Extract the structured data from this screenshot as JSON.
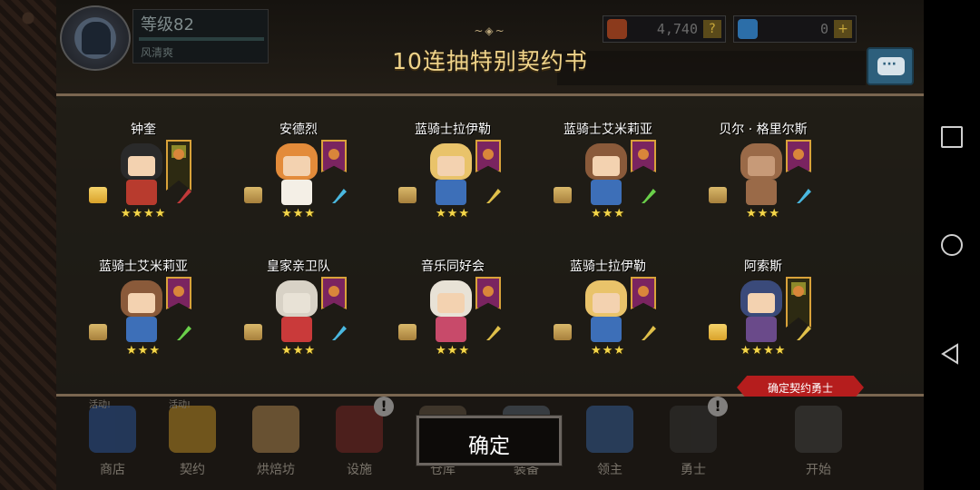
{
  "hud": {
    "level": "等级82",
    "player_name": "风清爽",
    "gold": "4,740",
    "gems": "0",
    "gold_btn": "?",
    "gem_btn": "+"
  },
  "title": "10连抽特别契约书",
  "title_ornament": "~◈~",
  "heroes": [
    {
      "name": "钟奎",
      "stars": "★★★★",
      "weapon": "sword"
    },
    {
      "name": "安德烈",
      "stars": "★★★",
      "weapon": "hammer"
    },
    {
      "name": "蓝骑士拉伊勒",
      "stars": "★★★",
      "weapon": "staff"
    },
    {
      "name": "蓝骑士艾米莉亚",
      "stars": "★★★",
      "weapon": "bow"
    },
    {
      "name": "贝尔 · 格里尔斯",
      "stars": "★★★",
      "weapon": "hammer"
    },
    {
      "name": "蓝骑士艾米莉亚",
      "stars": "★★★",
      "weapon": "bow"
    },
    {
      "name": "皇家亲卫队",
      "stars": "★★★",
      "weapon": "hammer"
    },
    {
      "name": "音乐同好会",
      "stars": "★★★",
      "weapon": "staff"
    },
    {
      "name": "蓝骑士拉伊勒",
      "stars": "★★★",
      "weapon": "staff"
    },
    {
      "name": "阿索斯",
      "stars": "★★★★",
      "weapon": "staff"
    }
  ],
  "confirm_tag": "确定契约勇士",
  "ok_button": "确定",
  "menu": [
    {
      "label": "商店",
      "tag": "活动!",
      "alert": ""
    },
    {
      "label": "契约",
      "tag": "活动!",
      "alert": ""
    },
    {
      "label": "烘焙坊",
      "tag": "",
      "alert": ""
    },
    {
      "label": "设施",
      "tag": "",
      "alert": "!"
    },
    {
      "label": "仓库",
      "tag": "",
      "alert": ""
    },
    {
      "label": "装备",
      "tag": "",
      "alert": ""
    },
    {
      "label": "领主",
      "tag": "",
      "alert": ""
    },
    {
      "label": "勇士",
      "tag": "",
      "alert": "!"
    },
    {
      "label": "开始",
      "tag": "",
      "alert": ""
    }
  ],
  "colors": {
    "title": "#f0d48a",
    "stars": "#f4d64a",
    "confirm_tag": "#b51d1d",
    "banner": "#7a2460"
  }
}
